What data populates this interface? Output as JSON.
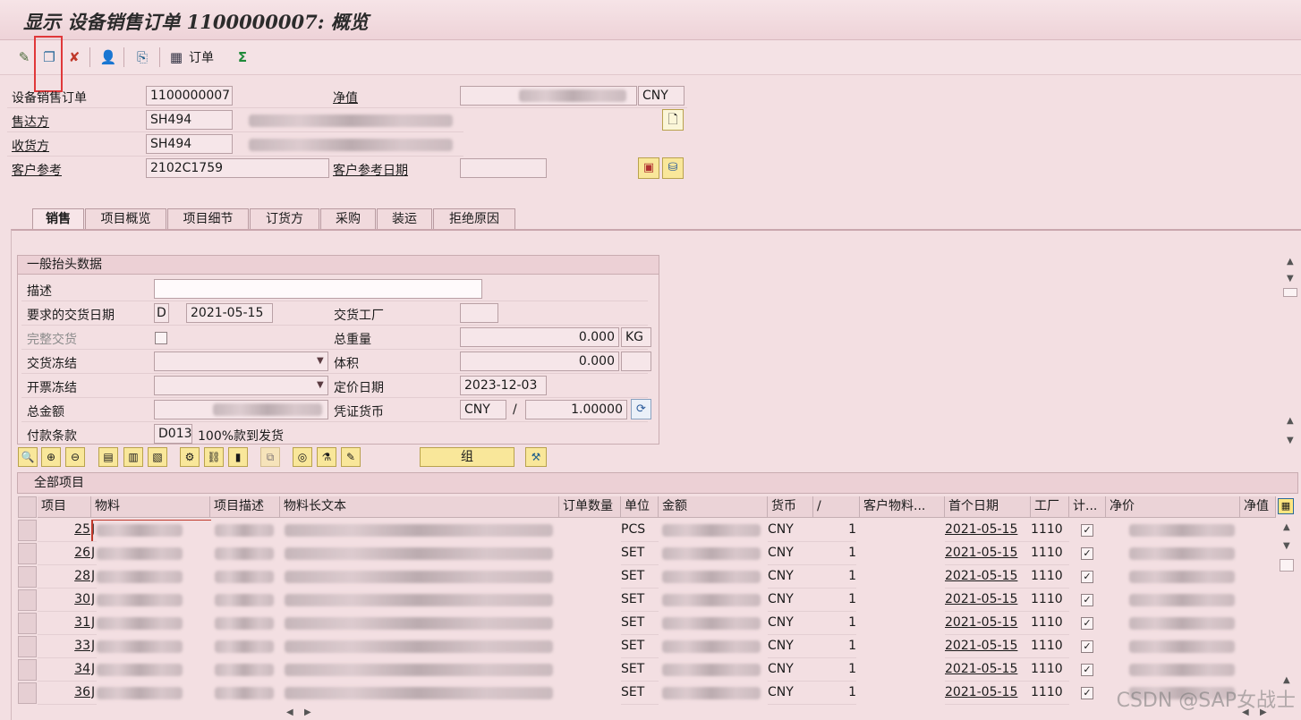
{
  "title": "显示 设备销售订单 1100000007: 概览",
  "toolbar": {
    "icons": [
      "display-change-icon",
      "copy-doc-icon",
      "checkmark-x-icon",
      "person-icon",
      "document-flow-icon",
      "order-grid-icon",
      "sigma-icon"
    ],
    "order_label": "订单"
  },
  "header": {
    "order_label": "设备销售订单",
    "order_value": "1100000007",
    "net_value_label": "净值",
    "currency": "CNY",
    "sold_to_label": "售达方",
    "sold_to_value": "SH494",
    "ship_to_label": "收货方",
    "ship_to_value": "SH494",
    "customer_ref_label": "客户参考",
    "customer_ref_value": "2102C1759",
    "customer_ref_date_label": "客户参考日期"
  },
  "tabs": [
    "销售",
    "项目概览",
    "项目细节",
    "订货方",
    "采购",
    "装运",
    "拒绝原因"
  ],
  "general": {
    "section_title": "一般抬头数据",
    "desc_label": "描述",
    "req_delivery_label": "要求的交货日期",
    "req_delivery_type": "D",
    "req_delivery_date": "2021-05-15",
    "delivery_plant_label": "交货工厂",
    "complete_delivery_label": "完整交货",
    "total_weight_label": "总重量",
    "total_weight_value": "0.000",
    "weight_unit": "KG",
    "delivery_block_label": "交货冻结",
    "volume_label": "体积",
    "volume_value": "0.000",
    "billing_block_label": "开票冻结",
    "pricing_date_label": "定价日期",
    "pricing_date_value": "2023-12-03",
    "total_amount_label": "总金额",
    "doc_currency_label": "凭证货币",
    "doc_currency_value": "CNY",
    "doc_currency_sep": "/",
    "exchange_rate": "1.00000",
    "payment_terms_label": "付款条款",
    "payment_terms_code": "D013",
    "payment_terms_text": "100%款到发货"
  },
  "items_toolbar": {
    "group_label": "组"
  },
  "items": {
    "title": "全部项目",
    "columns": [
      "项目",
      "物料",
      "项目描述",
      "物料长文本",
      "订单数量",
      "单位",
      "金额",
      "货币",
      "/",
      "客户物料...",
      "首个日期",
      "工厂",
      "计...",
      "净价",
      "净值"
    ],
    "rows": [
      {
        "item": "25",
        "unit": "PCS",
        "currency": "CNY",
        "per": "1",
        "date": "2021-05-15",
        "plant": "1110"
      },
      {
        "item": "26",
        "unit": "SET",
        "currency": "CNY",
        "per": "1",
        "date": "2021-05-15",
        "plant": "1110"
      },
      {
        "item": "28",
        "unit": "SET",
        "currency": "CNY",
        "per": "1",
        "date": "2021-05-15",
        "plant": "1110"
      },
      {
        "item": "30",
        "unit": "SET",
        "currency": "CNY",
        "per": "1",
        "date": "2021-05-15",
        "plant": "1110"
      },
      {
        "item": "31",
        "unit": "SET",
        "currency": "CNY",
        "per": "1",
        "date": "2021-05-15",
        "plant": "1110"
      },
      {
        "item": "33",
        "unit": "SET",
        "currency": "CNY",
        "per": "1",
        "date": "2021-05-15",
        "plant": "1110"
      },
      {
        "item": "34",
        "unit": "SET",
        "currency": "CNY",
        "per": "1",
        "date": "2021-05-15",
        "plant": "1110"
      },
      {
        "item": "36",
        "unit": "SET",
        "currency": "CNY",
        "per": "1",
        "date": "2021-05-15",
        "plant": "1110"
      }
    ]
  },
  "watermark": "CSDN @SAP女战士",
  "colors": {
    "background": "#f3dfe2",
    "highlight": "#e0383a"
  }
}
